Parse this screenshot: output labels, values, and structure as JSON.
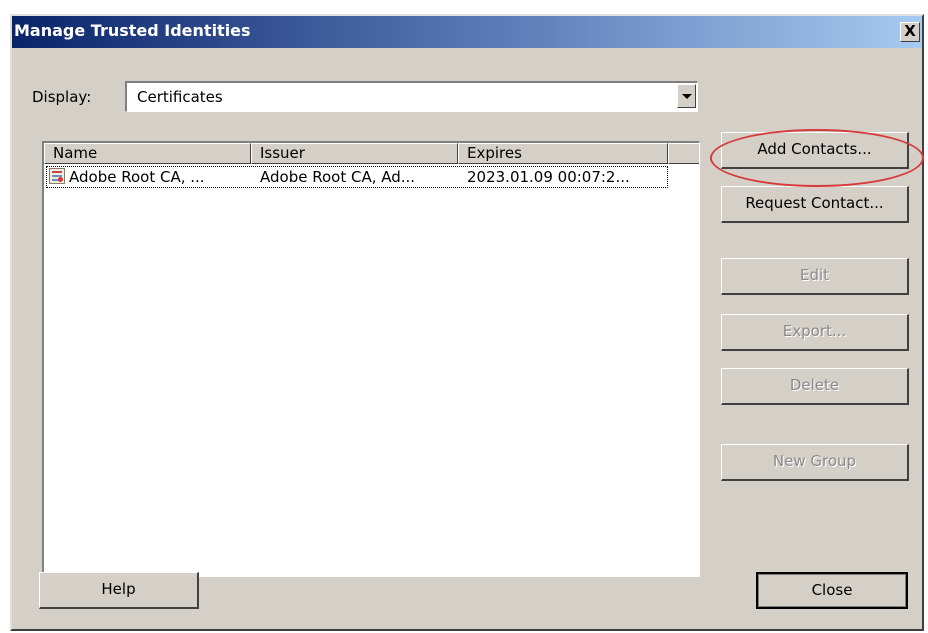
{
  "window": {
    "title": "Manage Trusted Identities",
    "close_glyph": "X"
  },
  "display": {
    "label": "Display:",
    "selected": "Certificates"
  },
  "list": {
    "columns": [
      "Name",
      "Issuer",
      "Expires"
    ],
    "rows": [
      {
        "icon": "certificate-icon",
        "name": "Adobe Root CA, ...",
        "issuer": "Adobe Root CA, Ad...",
        "expires": "2023.01.09 00:07:2..."
      }
    ]
  },
  "buttons": {
    "add_contacts": "Add Contacts...",
    "request_contact": "Request Contact...",
    "edit": "Edit",
    "export": "Export...",
    "delete": "Delete",
    "new_group": "New Group",
    "help": "Help",
    "close": "Close"
  },
  "colors": {
    "titlebar_start": "#0a246a",
    "titlebar_end": "#a6caf0",
    "dialog_face": "#d4d0c8",
    "annotation_oval": "#d63a3a"
  }
}
